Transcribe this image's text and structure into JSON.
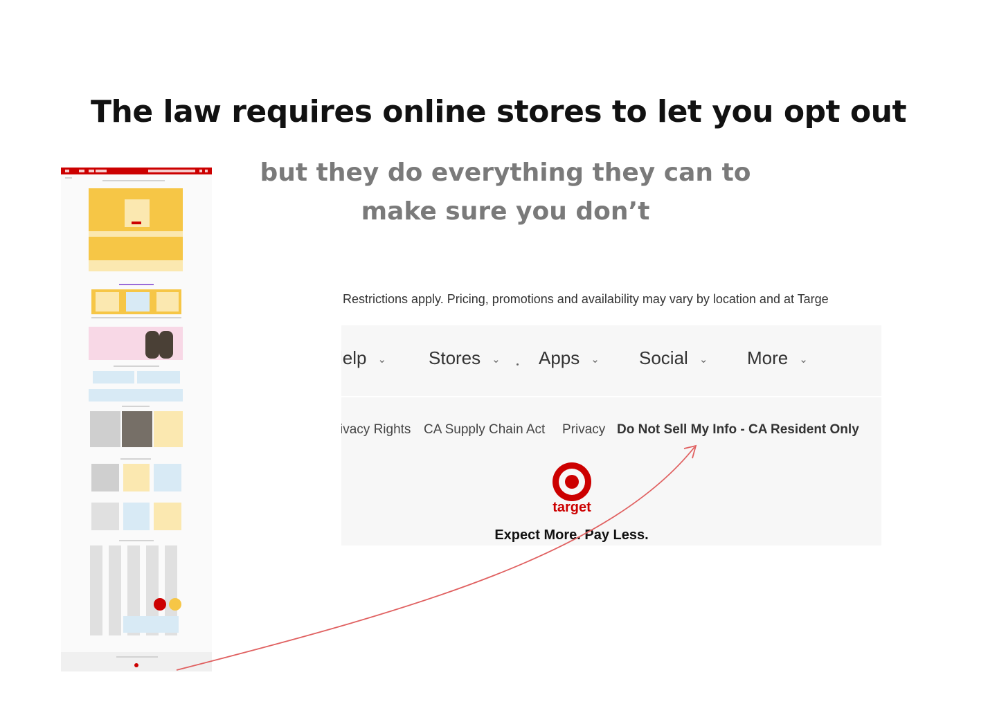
{
  "slide": {
    "title": "The law requires online stores to let you opt out",
    "subtitle_line1": "but they do everything they can to",
    "subtitle_line2": "make sure you don’t"
  },
  "crop": {
    "restrictions_text": "Restrictions apply. Pricing, promotions and availability may vary by location and at Targe",
    "nav": [
      {
        "label": "lelp"
      },
      {
        "label": "Stores"
      },
      {
        "label": "Apps"
      },
      {
        "label": "Social"
      },
      {
        "label": "More"
      }
    ],
    "chevron": "⌄",
    "footer_links": [
      {
        "label": "ivacy Rights"
      },
      {
        "label": "CA Supply Chain Act"
      },
      {
        "label": "Privacy"
      },
      {
        "label": "Do Not Sell My Info - CA Resident Only"
      }
    ],
    "brand_name": "target",
    "slogan": "Expect More. Pay Less."
  },
  "colors": {
    "brand_red": "#cc0000",
    "arrow": "#e06060",
    "subtitle_gray": "#7a7a7a"
  },
  "icons": {
    "logo": "target-bullseye-icon",
    "arrow": "curved-arrow-icon"
  }
}
